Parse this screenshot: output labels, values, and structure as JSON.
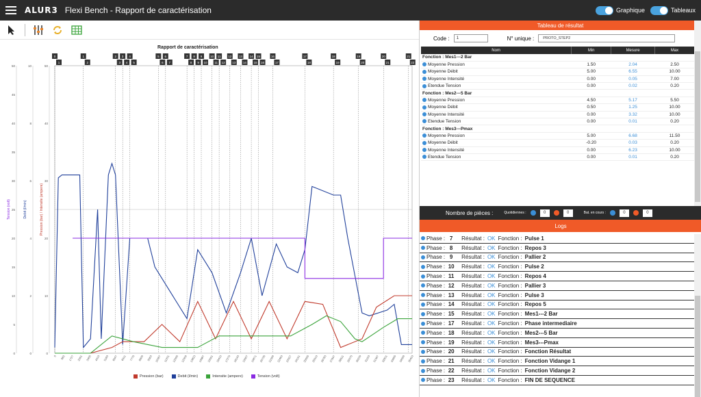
{
  "app": {
    "title": "Flexi Bench - Rapport de caractérisation",
    "logo": "ALUR3"
  },
  "toggles": [
    {
      "label": "Graphique",
      "on": true
    },
    {
      "label": "Tableaux",
      "on": true
    }
  ],
  "toolbar": {
    "icons": [
      "cursor-icon",
      "sliders-icon",
      "refresh-icon",
      "table-grid-icon"
    ]
  },
  "chart_data": {
    "type": "line",
    "title": "Rapport de caractérisation",
    "y_axes": [
      {
        "label": "Tension (volt)",
        "color": "#8a2be2",
        "ticks": [
          "0",
          "5",
          "10",
          "15",
          "20",
          "25",
          "30",
          "35",
          "40",
          "45",
          "50"
        ]
      },
      {
        "label": "Debit (l/min)",
        "color": "#1f3f9a",
        "ticks": [
          "0",
          "2",
          "4",
          "6",
          "8",
          "10"
        ]
      },
      {
        "label": "Pression (bar) / Intensite (ampere)",
        "color": "#c0392b",
        "ticks": [
          "0",
          "10",
          "20",
          "30",
          "40",
          "50"
        ]
      }
    ],
    "x_ticks": [
      "0",
      "863",
      "1727",
      "2591",
      "3455",
      "4319",
      "5183",
      "6047",
      "6911",
      "7775",
      "8639",
      "9503",
      "10367",
      "11231",
      "12095",
      "12959",
      "13823",
      "14687",
      "15551",
      "16415",
      "17279",
      "18143",
      "19007",
      "19871",
      "20735",
      "21599",
      "22463",
      "23327",
      "24191",
      "25055",
      "25919",
      "26783",
      "27647",
      "28511",
      "29375",
      "30239",
      "31103",
      "31967",
      "32831",
      "33695",
      "34559",
      "35423"
    ],
    "phase_markers_top": [
      "0",
      "1",
      "2",
      "3",
      "4",
      "5",
      "6",
      "7",
      "8",
      "9",
      "10",
      "11",
      "12",
      "13",
      "14",
      "15",
      "16",
      "17",
      "18",
      "19",
      "20",
      "21"
    ],
    "phase_markers_bottom": [
      "1",
      "2",
      "3",
      "4",
      "5",
      "6",
      "7",
      "8",
      "9",
      "10",
      "11",
      "12",
      "13",
      "14",
      "15",
      "16",
      "17",
      "18",
      "19",
      "20",
      "21",
      "22"
    ],
    "legend": [
      {
        "name": "Pression (bar)",
        "color": "#c0392b"
      },
      {
        "name": "Debit (l/min)",
        "color": "#1f3f9a"
      },
      {
        "name": "Intensite (ampere)",
        "color": "#3aa33a"
      },
      {
        "name": "Tension (volt)",
        "color": "#8a2be2"
      }
    ],
    "series": [
      {
        "name": "Debit (l/min)",
        "color": "#1f3f9a",
        "points": [
          [
            0.0,
            0.02
          ],
          [
            0.01,
            0.61
          ],
          [
            0.02,
            0.62
          ],
          [
            0.07,
            0.62
          ],
          [
            0.08,
            0.02
          ],
          [
            0.1,
            0.05
          ],
          [
            0.12,
            0.5
          ],
          [
            0.13,
            0.05
          ],
          [
            0.15,
            0.62
          ],
          [
            0.16,
            0.66
          ],
          [
            0.17,
            0.62
          ],
          [
            0.19,
            0.03
          ],
          [
            0.21,
            0.4
          ],
          [
            0.26,
            0.4
          ],
          [
            0.28,
            0.3
          ],
          [
            0.32,
            0.22
          ],
          [
            0.37,
            0.12
          ],
          [
            0.4,
            0.36
          ],
          [
            0.44,
            0.28
          ],
          [
            0.48,
            0.14
          ],
          [
            0.52,
            0.28
          ],
          [
            0.55,
            0.4
          ],
          [
            0.58,
            0.2
          ],
          [
            0.62,
            0.38
          ],
          [
            0.65,
            0.3
          ],
          [
            0.68,
            0.28
          ],
          [
            0.7,
            0.36
          ],
          [
            0.72,
            0.58
          ],
          [
            0.78,
            0.55
          ],
          [
            0.8,
            0.55
          ],
          [
            0.82,
            0.4
          ],
          [
            0.86,
            0.14
          ],
          [
            0.88,
            0.13
          ],
          [
            0.93,
            0.15
          ],
          [
            0.95,
            0.17
          ],
          [
            0.97,
            0.03
          ],
          [
            1.0,
            0.03
          ]
        ]
      },
      {
        "name": "Pression (bar)",
        "color": "#c0392b",
        "points": [
          [
            0.0,
            0.0
          ],
          [
            0.1,
            0.0
          ],
          [
            0.16,
            0.02
          ],
          [
            0.19,
            0.04
          ],
          [
            0.25,
            0.04
          ],
          [
            0.3,
            0.1
          ],
          [
            0.35,
            0.04
          ],
          [
            0.4,
            0.18
          ],
          [
            0.45,
            0.05
          ],
          [
            0.5,
            0.18
          ],
          [
            0.55,
            0.05
          ],
          [
            0.6,
            0.18
          ],
          [
            0.65,
            0.05
          ],
          [
            0.7,
            0.18
          ],
          [
            0.75,
            0.17
          ],
          [
            0.8,
            0.02
          ],
          [
            0.86,
            0.05
          ],
          [
            0.9,
            0.16
          ],
          [
            0.95,
            0.2
          ],
          [
            1.0,
            0.2
          ]
        ]
      },
      {
        "name": "Intensite (ampere)",
        "color": "#3aa33a",
        "points": [
          [
            0.0,
            0.0
          ],
          [
            0.1,
            0.0
          ],
          [
            0.16,
            0.06
          ],
          [
            0.22,
            0.04
          ],
          [
            0.3,
            0.02
          ],
          [
            0.4,
            0.02
          ],
          [
            0.46,
            0.06
          ],
          [
            0.54,
            0.06
          ],
          [
            0.6,
            0.06
          ],
          [
            0.66,
            0.06
          ],
          [
            0.72,
            0.1
          ],
          [
            0.76,
            0.13
          ],
          [
            0.8,
            0.11
          ],
          [
            0.84,
            0.05
          ],
          [
            0.86,
            0.04
          ],
          [
            0.92,
            0.09
          ],
          [
            0.96,
            0.12
          ],
          [
            1.0,
            0.12
          ]
        ]
      },
      {
        "name": "Tension (volt)",
        "color": "#8a2be2",
        "points": [
          [
            0.05,
            0.4
          ],
          [
            0.06,
            0.4
          ],
          [
            0.7,
            0.4
          ],
          [
            0.7,
            0.26
          ],
          [
            0.92,
            0.26
          ],
          [
            0.92,
            0.4
          ],
          [
            1.0,
            0.4
          ]
        ]
      }
    ]
  },
  "results": {
    "header": "Tableau de résultat",
    "code_label": "Code :",
    "code_value": "1",
    "unique_label": "N° unique :",
    "unique_value": "PROTO_STEP2",
    "columns": [
      "Nom",
      "Min",
      "Mesure",
      "Max"
    ],
    "rows": [
      {
        "type": "fn",
        "name": "Fonction : Mes1---2 Bar"
      },
      {
        "type": "row",
        "name": "Moyenne Pression",
        "min": "1.50",
        "mes": "2.04",
        "max": "2.50"
      },
      {
        "type": "row",
        "name": "Moyenne Débit",
        "min": "5.00",
        "mes": "6.55",
        "max": "10.00"
      },
      {
        "type": "row",
        "name": "Moyenne Intensité",
        "min": "0.00",
        "mes": "0.05",
        "max": "7.00"
      },
      {
        "type": "row",
        "name": "Etendue Tension",
        "min": "0.00",
        "mes": "0.02",
        "max": "0.20"
      },
      {
        "type": "fn",
        "name": "Fonction : Mes2---5 Bar"
      },
      {
        "type": "row",
        "name": "Moyenne Pression",
        "min": "4.50",
        "mes": "5.17",
        "max": "5.50"
      },
      {
        "type": "row",
        "name": "Moyenne Débit",
        "min": "0.50",
        "mes": "1.25",
        "max": "10.00"
      },
      {
        "type": "row",
        "name": "Moyenne Intensité",
        "min": "0.00",
        "mes": "3.32",
        "max": "10.00"
      },
      {
        "type": "row",
        "name": "Etendue Tension",
        "min": "0.00",
        "mes": "0.01",
        "max": "0.20"
      },
      {
        "type": "fn",
        "name": "Fonction : Mes3---Pmax"
      },
      {
        "type": "row",
        "name": "Moyenne Pression",
        "min": "5.00",
        "mes": "6.68",
        "max": "11.50"
      },
      {
        "type": "row",
        "name": "Moyenne Débit",
        "min": "-0.20",
        "mes": "0.03",
        "max": "0.20"
      },
      {
        "type": "row",
        "name": "Moyenne Intensité",
        "min": "0.00",
        "mes": "6.23",
        "max": "10.00"
      },
      {
        "type": "row",
        "name": "Etendue Tension",
        "min": "0.00",
        "mes": "0.01",
        "max": "0.20"
      }
    ]
  },
  "counters": {
    "label": "Nombre de pièces :",
    "quotidiennes_label": "Quotidiennes :",
    "quotidiennes_ok": "0",
    "quotidiennes_nok": "0",
    "en_cours_label": "Bat. en cours :",
    "en_cours_ok": "0",
    "en_cours_nok": "0"
  },
  "logs": {
    "header": "Logs",
    "rows": [
      {
        "phase": "7",
        "res": "OK",
        "fn": "Pulse 1"
      },
      {
        "phase": "8",
        "res": "OK",
        "fn": "Repos 3"
      },
      {
        "phase": "9",
        "res": "OK",
        "fn": "Pallier 2"
      },
      {
        "phase": "10",
        "res": "OK",
        "fn": "Pulse 2"
      },
      {
        "phase": "11",
        "res": "OK",
        "fn": "Repos 4"
      },
      {
        "phase": "12",
        "res": "OK",
        "fn": "Pallier 3"
      },
      {
        "phase": "13",
        "res": "OK",
        "fn": "Pulse 3"
      },
      {
        "phase": "14",
        "res": "OK",
        "fn": "Repos 5"
      },
      {
        "phase": "15",
        "res": "OK",
        "fn": "Mes1---2 Bar"
      },
      {
        "phase": "17",
        "res": "OK",
        "fn": "Phase intermediaire"
      },
      {
        "phase": "18",
        "res": "OK",
        "fn": "Mes2---5 Bar"
      },
      {
        "phase": "19",
        "res": "OK",
        "fn": "Mes3---Pmax"
      },
      {
        "phase": "20",
        "res": "OK",
        "fn": "Fonction Résultat"
      },
      {
        "phase": "21",
        "res": "OK",
        "fn": "Fonction Vidange 1"
      },
      {
        "phase": "22",
        "res": "OK",
        "fn": "Fonction Vidange 2"
      },
      {
        "phase": "23",
        "res": "OK",
        "fn": "FIN DE SEQUENCE"
      }
    ],
    "phase_label": "Phase :",
    "result_label": "Résultat :",
    "function_label": "Fonction :"
  }
}
